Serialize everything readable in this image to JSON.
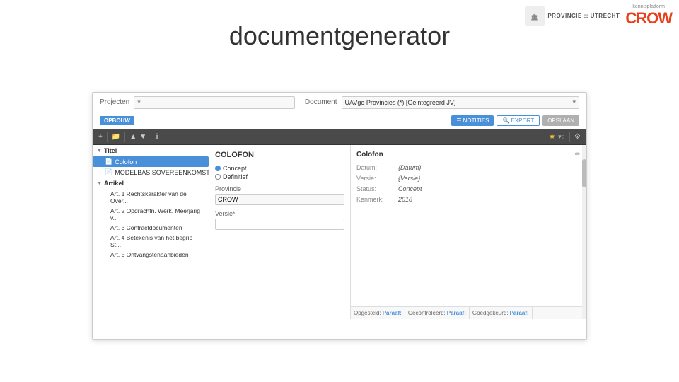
{
  "header": {
    "province_text": "PROVINCIE :: UTRECHT",
    "crow_text": "CROW",
    "crow_subtitle": "kennisplatform"
  },
  "title": "documentgenerator",
  "mockup": {
    "top_bar": {
      "projecten_label": "Projecten",
      "document_label": "Document",
      "document_value": "UAVgc-Provincies (*) [Geintegreerd JV]"
    },
    "action_bar": {
      "opbouw_label": "OPBOUW",
      "btn_notities": "NOTITIES",
      "btn_export": "EXPORT",
      "btn_oplaan": "OPSLAAN"
    },
    "toolbar": {
      "add_icon": "+",
      "folder_icon": "📁",
      "arrow_up": "▲",
      "arrow_down": "▼",
      "star_icon": "★",
      "filter_icon": "▾",
      "gear_icon": "⚙"
    },
    "left_pane": {
      "title_label": "Titel",
      "items": [
        {
          "label": "Colofon",
          "active": true,
          "indent": 2
        },
        {
          "label": "MODELBASISOVEREENKOMST",
          "active": false,
          "indent": 2
        },
        {
          "label": "Artikel",
          "active": false,
          "indent": 1
        },
        {
          "label": "Art. 1 Rechtskarakter van de Over...",
          "active": false,
          "indent": 3
        },
        {
          "label": "Art. 2 Opdrachtv. Werk. Meerjarig v...",
          "active": false,
          "indent": 3
        },
        {
          "label": "Art. 3 Contractdocumenten",
          "active": false,
          "indent": 3
        },
        {
          "label": "Art. 4 Betekenis van het begrip St...",
          "active": false,
          "indent": 3
        },
        {
          "label": "Art. 5 Ontvangstenaanbieden",
          "active": false,
          "indent": 3
        }
      ]
    },
    "middle_pane": {
      "title": "COLOFON",
      "status_label": "",
      "status_options": [
        "Concept",
        "Definitief"
      ],
      "status_selected": "Concept",
      "provincie_label": "Provincie",
      "provincie_value": "CROW",
      "versie_label": "Versie*",
      "versie_value": ""
    },
    "right_pane": {
      "title": "Colofon",
      "datum_label": "Datum:",
      "datum_value": "{Datum}",
      "versie_label": "Versie:",
      "versie_value": "{Versie}",
      "status_label": "Status:",
      "status_value": "Concept",
      "kenmerk_label": "Kenmerk:",
      "kenmerk_value": "2018"
    },
    "approval_bar": {
      "items": [
        {
          "label": "Opgesteld:",
          "value": "Paraaf:"
        },
        {
          "label": "Gecontroleerd:",
          "value": "Paraaf:"
        },
        {
          "label": "Goedgekeurd:",
          "value": "Paraaf:"
        }
      ]
    }
  }
}
